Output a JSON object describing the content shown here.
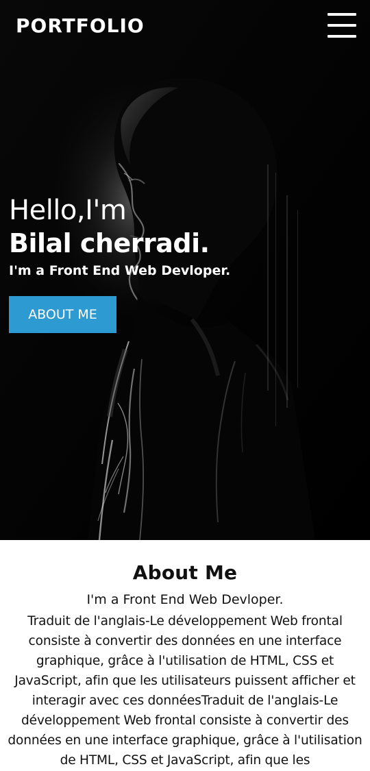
{
  "header": {
    "brand": "PORTFOLIO",
    "menu_icon": "hamburger-menu-icon"
  },
  "hero": {
    "greeting": "Hello,I'm",
    "name": "Bilal cherradi.",
    "role": "I'm a Front End Web Devloper.",
    "button_label": "ABOUT ME",
    "button_color": "#2d9ad1",
    "background_color": "#050505"
  },
  "about": {
    "title": "About Me",
    "subtitle": "I'm a Front End Web Devloper.",
    "text": "Traduit de l'anglais-Le développement Web frontal consiste à convertir des données en une interface graphique, grâce à l'utilisation de HTML, CSS et JavaScript, afin que les utilisateurs puissent afficher et interagir avec ces donnéesTraduit de l'anglais-Le développement Web frontal consiste à convertir des données en une interface graphique, grâce à l'utilisation de HTML, CSS et JavaScript, afin que les"
  }
}
